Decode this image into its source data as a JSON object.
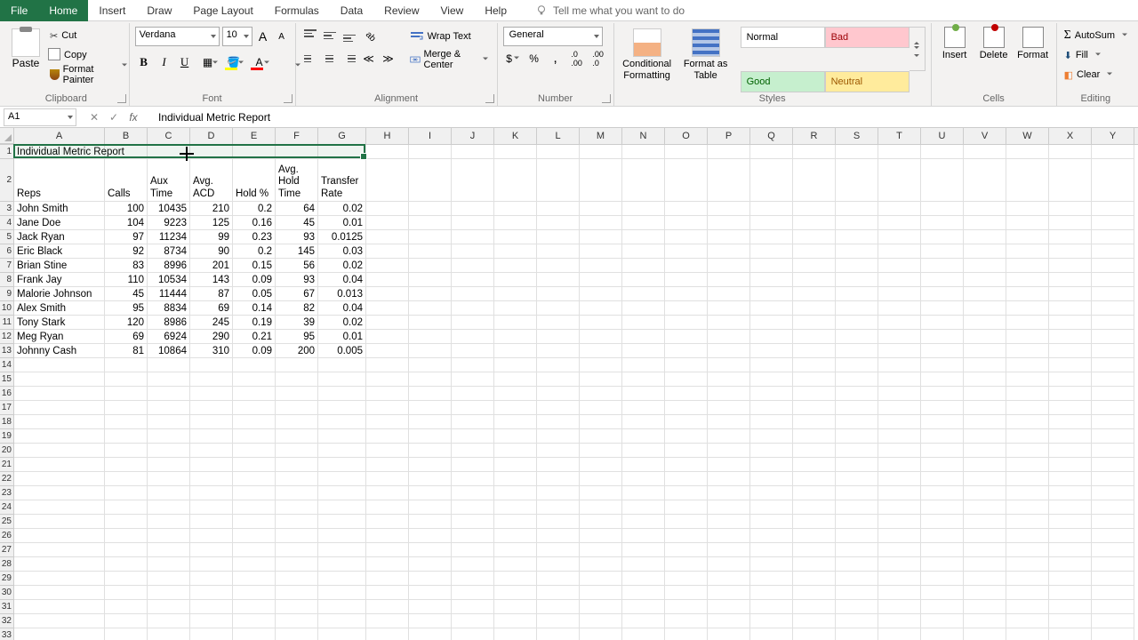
{
  "tabs": {
    "file": "File",
    "list": [
      "Home",
      "Insert",
      "Draw",
      "Page Layout",
      "Formulas",
      "Data",
      "Review",
      "View",
      "Help"
    ],
    "active": "Home",
    "tellme": "Tell me what you want to do"
  },
  "ribbon": {
    "clipboard": {
      "label": "Clipboard",
      "paste": "Paste",
      "cut": "Cut",
      "copy": "Copy",
      "painter": "Format Painter"
    },
    "font": {
      "label": "Font",
      "name": "Verdana",
      "size": "10"
    },
    "alignment": {
      "label": "Alignment",
      "wrap": "Wrap Text",
      "merge": "Merge & Center"
    },
    "number": {
      "label": "Number",
      "format": "General"
    },
    "styles": {
      "label": "Styles",
      "conditional": "Conditional Formatting",
      "format_table": "Format as Table",
      "cells": {
        "normal": "Normal",
        "bad": "Bad",
        "good": "Good",
        "neutral": "Neutral"
      }
    },
    "cells_grp": {
      "label": "Cells",
      "insert": "Insert",
      "delete": "Delete",
      "format": "Format"
    },
    "editing": {
      "label": "Editing",
      "autosum": "AutoSum",
      "fill": "Fill",
      "clear": "Clear"
    }
  },
  "formula_bar": {
    "name_box": "A1",
    "fx": "fx",
    "value": "Individual Metric Report"
  },
  "columns": [
    "A",
    "B",
    "C",
    "D",
    "E",
    "F",
    "G",
    "H",
    "I",
    "J",
    "K",
    "L",
    "M",
    "N",
    "O",
    "P",
    "Q",
    "R",
    "S",
    "T",
    "U",
    "V",
    "W",
    "X",
    "Y"
  ],
  "col_widths": {
    "A": 102,
    "B": 48,
    "C": 48,
    "D": 48,
    "E": 48,
    "F": 48,
    "G": 54,
    "default": 48
  },
  "row_default_h": 16,
  "row2_h": 48,
  "num_blank_rows": 20,
  "sheet": {
    "title": "Individual Metric Report",
    "headers": [
      "Reps",
      "Calls",
      "Aux Time",
      "Avg. ACD",
      "Hold %",
      "Avg. Hold Time",
      "Transfer Rate"
    ],
    "rows": [
      {
        "rep": "John Smith",
        "calls": 100,
        "aux": 10435,
        "acd": 210,
        "hold": 0.2,
        "avghold": 64,
        "transfer": 0.02
      },
      {
        "rep": "Jane Doe",
        "calls": 104,
        "aux": 9223,
        "acd": 125,
        "hold": 0.16,
        "avghold": 45,
        "transfer": 0.01
      },
      {
        "rep": "Jack Ryan",
        "calls": 97,
        "aux": 11234,
        "acd": 99,
        "hold": 0.23,
        "avghold": 93,
        "transfer": 0.0125
      },
      {
        "rep": "Eric Black",
        "calls": 92,
        "aux": 8734,
        "acd": 90,
        "hold": 0.2,
        "avghold": 145,
        "transfer": 0.03
      },
      {
        "rep": "Brian Stine",
        "calls": 83,
        "aux": 8996,
        "acd": 201,
        "hold": 0.15,
        "avghold": 56,
        "transfer": 0.02
      },
      {
        "rep": "Frank Jay",
        "calls": 110,
        "aux": 10534,
        "acd": 143,
        "hold": 0.09,
        "avghold": 93,
        "transfer": 0.04
      },
      {
        "rep": "Malorie Johnson",
        "calls": 45,
        "aux": 11444,
        "acd": 87,
        "hold": 0.05,
        "avghold": 67,
        "transfer": 0.013
      },
      {
        "rep": "Alex Smith",
        "calls": 95,
        "aux": 8834,
        "acd": 69,
        "hold": 0.14,
        "avghold": 82,
        "transfer": 0.04
      },
      {
        "rep": "Tony Stark",
        "calls": 120,
        "aux": 8986,
        "acd": 245,
        "hold": 0.19,
        "avghold": 39,
        "transfer": 0.02
      },
      {
        "rep": "Meg Ryan",
        "calls": 69,
        "aux": 6924,
        "acd": 290,
        "hold": 0.21,
        "avghold": 95,
        "transfer": 0.01
      },
      {
        "rep": "Johnny Cash",
        "calls": 81,
        "aux": 10864,
        "acd": 310,
        "hold": 0.09,
        "avghold": 200,
        "transfer": 0.005
      }
    ]
  },
  "chart_data": {
    "type": "table",
    "title": "Individual Metric Report",
    "columns": [
      "Reps",
      "Calls",
      "Aux Time",
      "Avg. ACD",
      "Hold %",
      "Avg. Hold Time",
      "Transfer Rate"
    ],
    "data": [
      [
        "John Smith",
        100,
        10435,
        210,
        0.2,
        64,
        0.02
      ],
      [
        "Jane Doe",
        104,
        9223,
        125,
        0.16,
        45,
        0.01
      ],
      [
        "Jack Ryan",
        97,
        11234,
        99,
        0.23,
        93,
        0.0125
      ],
      [
        "Eric Black",
        92,
        8734,
        90,
        0.2,
        145,
        0.03
      ],
      [
        "Brian Stine",
        83,
        8996,
        201,
        0.15,
        56,
        0.02
      ],
      [
        "Frank Jay",
        110,
        10534,
        143,
        0.09,
        93,
        0.04
      ],
      [
        "Malorie Johnson",
        45,
        11444,
        87,
        0.05,
        67,
        0.013
      ],
      [
        "Alex Smith",
        95,
        8834,
        69,
        0.14,
        82,
        0.04
      ],
      [
        "Tony Stark",
        120,
        8986,
        245,
        0.19,
        39,
        0.02
      ],
      [
        "Meg Ryan",
        69,
        6924,
        290,
        0.21,
        95,
        0.01
      ],
      [
        "Johnny Cash",
        81,
        10864,
        310,
        0.09,
        200,
        0.005
      ]
    ]
  }
}
